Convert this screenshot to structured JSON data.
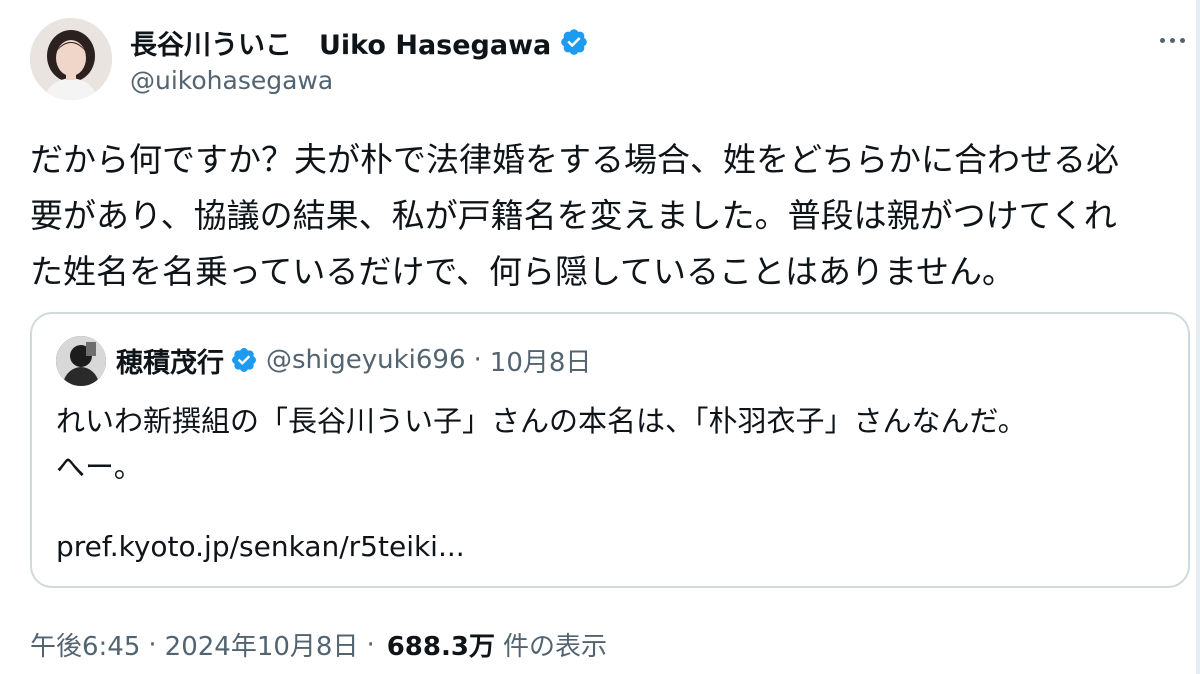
{
  "author": {
    "display_name": "長谷川ういこ　Uiko Hasegawa",
    "handle": "@uikohasegawa",
    "verified": true
  },
  "tweet": {
    "lines": [
      "だから何ですか？夫が朴で法律婚をする場合、姓をどちらかに合わせる必",
      "要があり、協議の結果、私が戸籍名を変えました。普段は親がつけてくれ",
      "た姓名を名乗っているだけで、何ら隠していることはありません。"
    ]
  },
  "quote": {
    "name": "穂積茂行",
    "handle": "@shigeyuki696",
    "separator": "·",
    "date": "10月8日",
    "verified": true,
    "lines": [
      "れいわ新撰組の「長谷川うい子」さんの本名は、「朴羽衣子」さんなんだ。",
      "へー。"
    ],
    "link": "pref.kyoto.jp/senkan/r5teiki..."
  },
  "meta": {
    "time": "午後6:45",
    "date": "2024年10月8日",
    "separator": "·",
    "views": "688.3万",
    "views_label": "件の表示"
  },
  "colors": {
    "verified_badge": "#1d9bf0",
    "secondary_text": "#536471",
    "primary_text": "#0f1419",
    "border": "#cfd9de"
  },
  "icons": {
    "verified": "verified-badge-icon",
    "more": "more-options-icon"
  }
}
